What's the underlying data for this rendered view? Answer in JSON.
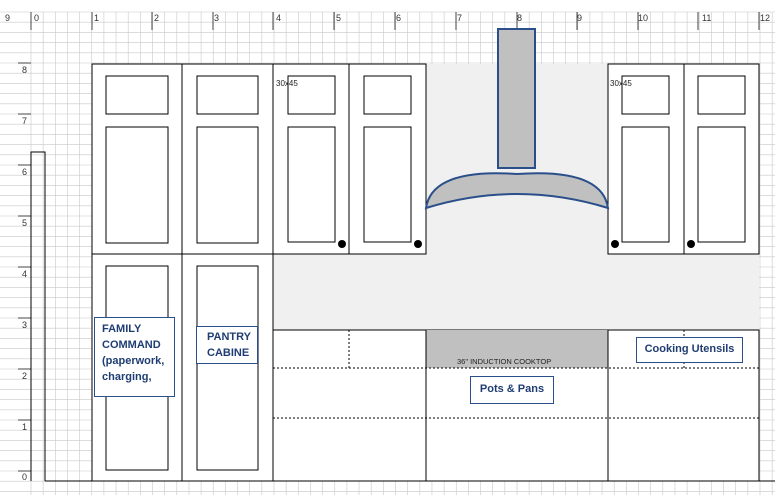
{
  "ruler": {
    "top": [
      "9",
      "0",
      "1",
      "2",
      "3",
      "4",
      "5",
      "6",
      "7",
      "8",
      "9",
      "10",
      "11",
      "12"
    ],
    "left": [
      "8",
      "7",
      "6",
      "5",
      "4",
      "3",
      "2",
      "1",
      "0"
    ]
  },
  "cabinet_size_labels": [
    "30x45",
    "30x45"
  ],
  "labels": {
    "family_command": "FAMILY COMMAND (paperwork, charging,",
    "pantry": "PANTRY CABINE",
    "cooktop": "36\" INDUCTION COOKTOP",
    "pots_pans": "Pots & Pans",
    "cooking_utensils": "Cooking Utensils"
  },
  "colors": {
    "grid": "#c8c8c8",
    "line": "#000000",
    "hood_fill": "#c0c0c0",
    "hood_stroke": "#2b4f8a",
    "backsplash": "#f0f0f0",
    "cooktop_fill": "#c0c0c0",
    "label_text": "#1f3d73"
  }
}
